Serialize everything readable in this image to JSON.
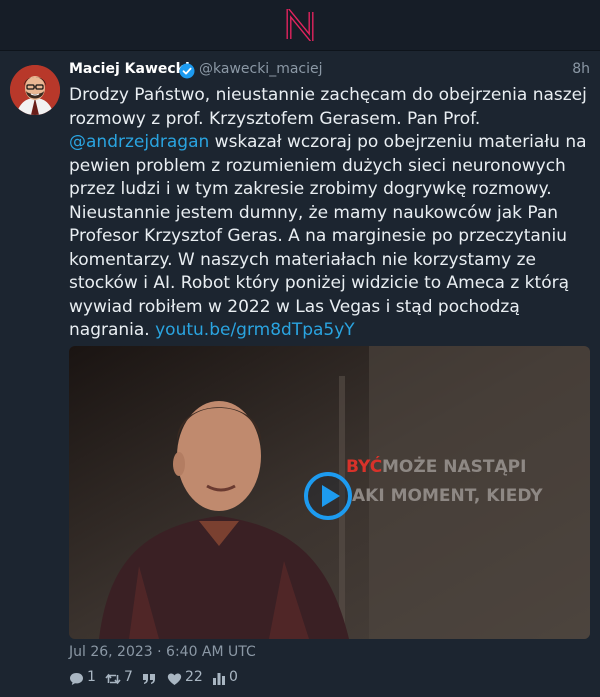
{
  "app": {
    "logo_icon": "nitter-n-logo",
    "accent": "#e0245e"
  },
  "tweet": {
    "author_name": "Maciej Kawecki",
    "author_handle": "@kawecki_maciej",
    "verified_icon": "verified-badge-icon",
    "relative_time": "8h",
    "text_1": "Drodzy Państwo, nieustannie zachęcam do obejrzenia naszej rozmowy z prof. Krzysztofem Gerasem. Pan Prof. ",
    "mention": "@andrzejdragan",
    "text_2": " wskazał wczoraj po obejrzeniu materiału na pewien problem z rozumieniem dużych sieci neuronowych przez ludzi i w tym zakresie zrobimy dogrywkę rozmowy. Nieustannie jestem dumny, że mamy naukowców jak Pan Profesor Krzysztof Geras. A na marginesie po przeczytaniu komentarzy. W naszych materiałach nie korzystamy ze stocków i AI. Robot który poniżej widzicie to Ameca z którą wywiad robiłem w 2022 w Las Vegas i stąd pochodzą nagrania. ",
    "link": "youtu.be/grm8dTpa5yY",
    "video": {
      "overlay_line_1_a": "BYĆ",
      "overlay_line_1_b": "MOŻE NASTĄPI",
      "overlay_line_2": "AKI MOMENT, KIEDY"
    },
    "date": "Jul 26, 2023 · 6:40 AM UTC",
    "stats": {
      "replies": "1",
      "retweets": "7",
      "quotes": "",
      "likes": "22",
      "views": "0"
    }
  },
  "colors": {
    "background": "#141b24",
    "card": "#1c2530",
    "link": "#2aa4e0",
    "play": "#1d9bf0"
  }
}
